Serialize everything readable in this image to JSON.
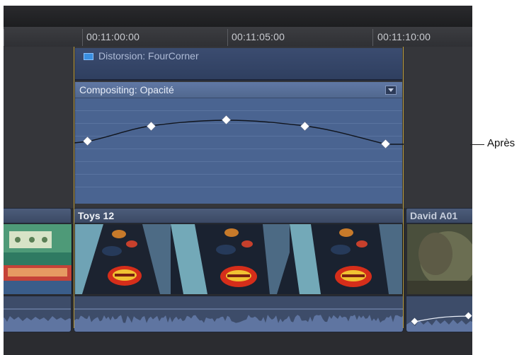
{
  "ruler": {
    "timecodes": [
      "00:11:00:00",
      "00:11:05:00",
      "00:11:10:00"
    ]
  },
  "effect_bar": {
    "label": "Distorsion: FourCorner",
    "icon": "effect-icon"
  },
  "compositing": {
    "label": "Compositing: Opacité",
    "menu_icon": "disclosure-menu-icon",
    "keyframe_count": 5
  },
  "callout": {
    "label": "Après"
  },
  "clips": [
    {
      "title": ""
    },
    {
      "title": "Toys 12"
    },
    {
      "title": "David A01"
    }
  ],
  "colors": {
    "selection_border": "#b89a3a",
    "compositing_bg": "#4a6491",
    "effect_bg": "#3b4c70",
    "keyframe": "#ffffff"
  }
}
